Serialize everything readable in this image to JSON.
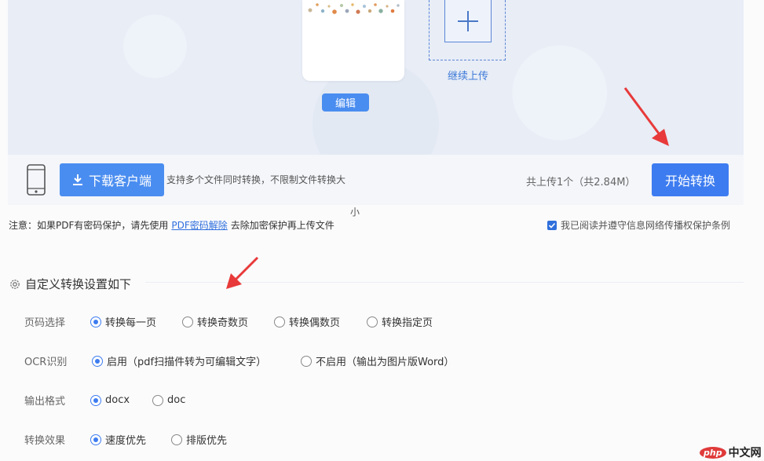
{
  "upload": {
    "edit_label": "编辑",
    "continue_label": "继续上传"
  },
  "toolbar": {
    "download_label": "下载客户端",
    "support_text": "支持多个文件同时转换，不限制文件转换大",
    "support_text_wrap": "小",
    "total_text": "共上传1个（共2.84M）",
    "start_label": "开始转换"
  },
  "notice": {
    "prefix": "注意：如果PDF有密码保护，请先使用",
    "link": "PDF密码解除",
    "suffix": "去除加密保护再上传文件"
  },
  "agreement": {
    "checked": true,
    "label": "我已阅读并遵守信息网络传播权保护条例"
  },
  "settings": {
    "title": "自定义转换设置如下",
    "rows": [
      {
        "label": "页码选择",
        "options": [
          "转换每一页",
          "转换奇数页",
          "转换偶数页",
          "转换指定页"
        ],
        "selected": 0
      },
      {
        "label": "OCR识别",
        "options": [
          "启用（pdf扫描件转为可编辑文字）",
          "不启用（输出为图片版Word）"
        ],
        "selected": 0
      },
      {
        "label": "输出格式",
        "options": [
          "docx",
          "doc"
        ],
        "selected": 0
      },
      {
        "label": "转换效果",
        "options": [
          "速度优先",
          "排版优先"
        ],
        "selected": 0
      }
    ]
  },
  "watermark": {
    "badge": "php",
    "text": "中文网"
  },
  "colors": {
    "primary": "#3d7cf0",
    "link": "#2f6fdc",
    "arrow": "#e83a3a"
  }
}
